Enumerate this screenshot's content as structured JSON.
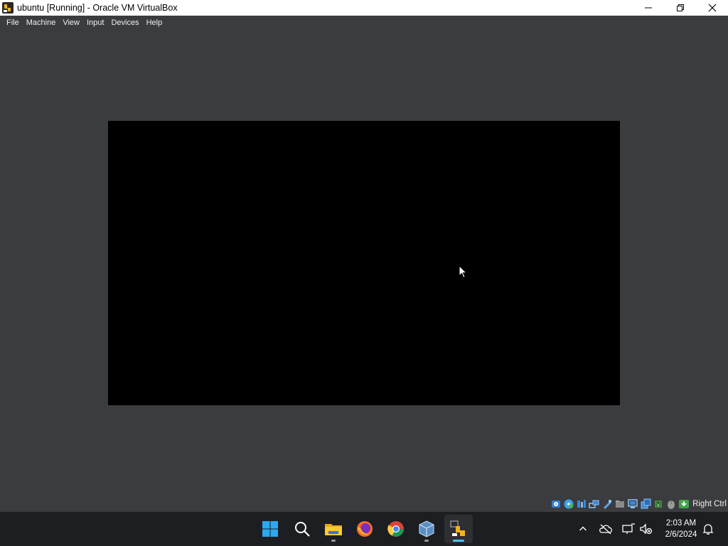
{
  "window": {
    "title": "ubuntu [Running] - Oracle VM VirtualBox",
    "controls": {
      "minimize": "minimize-icon",
      "maximize": "restore-icon",
      "close": "close-icon"
    }
  },
  "menu": {
    "items": [
      "File",
      "Machine",
      "View",
      "Input",
      "Devices",
      "Help"
    ]
  },
  "vm": {
    "screen_color": "#000000"
  },
  "statusbar": {
    "icons": [
      "hard-disk-icon",
      "optical-drive-icon",
      "audio-icon",
      "network-icon",
      "usb-icon",
      "shared-folders-icon",
      "display-icon",
      "recording-icon",
      "cpu-icon",
      "mouse-integration-icon",
      "keyboard-icon"
    ],
    "host_key": "Right Ctrl"
  },
  "taskbar": {
    "apps": [
      "windows-start-icon",
      "search-icon",
      "file-explorer-icon",
      "firefox-icon",
      "chrome-icon",
      "virtualbox-manager-icon",
      "virtualbox-vm-icon"
    ],
    "tray": [
      "show-hidden-icons-chevron",
      "onedrive-icon",
      "network-icon",
      "volume-muted-icon"
    ],
    "clock": {
      "time": "2:03 AM",
      "date": "2/6/2024"
    },
    "notification": "notification-bell-icon"
  }
}
